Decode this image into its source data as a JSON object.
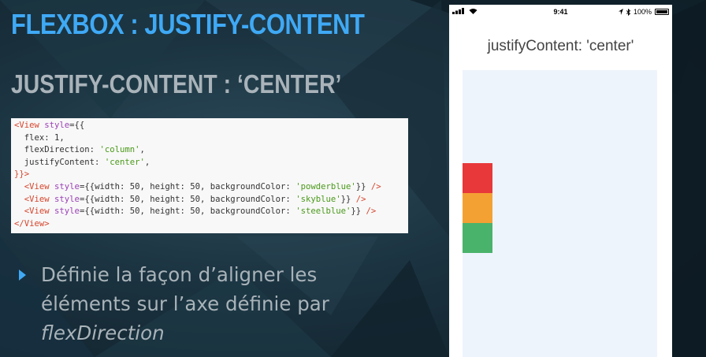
{
  "slide": {
    "title": "FLEXBOX : JUSTIFY-CONTENT",
    "subtitle": "JUSTIFY-CONTENT : ‘CENTER’",
    "accent_color": "#3fa9f5",
    "bullet": {
      "line1": "Définie la façon d’aligner les",
      "line2": "éléments sur l’axe définie par",
      "line3": "flexDirection"
    }
  },
  "code": {
    "lines": [
      [
        {
          "t": "tag",
          "v": "<View"
        },
        {
          "t": "attr",
          "v": " style"
        },
        {
          "t": "punc",
          "v": "={{"
        }
      ],
      [
        {
          "t": "prop",
          "v": "  flex: "
        },
        {
          "t": "num",
          "v": "1"
        },
        {
          "t": "punc",
          "v": ","
        }
      ],
      [
        {
          "t": "prop",
          "v": "  flexDirection: "
        },
        {
          "t": "str",
          "v": "'column'"
        },
        {
          "t": "punc",
          "v": ","
        }
      ],
      [
        {
          "t": "prop",
          "v": "  justifyContent: "
        },
        {
          "t": "str",
          "v": "'center'"
        },
        {
          "t": "punc",
          "v": ","
        }
      ],
      [
        {
          "t": "tag",
          "v": "}}>"
        }
      ],
      [
        {
          "t": "tag",
          "v": "  <View"
        },
        {
          "t": "attr",
          "v": " style"
        },
        {
          "t": "punc",
          "v": "={{width: 50, height: 50, backgroundColor: "
        },
        {
          "t": "str",
          "v": "'powderblue'"
        },
        {
          "t": "punc",
          "v": "}} "
        },
        {
          "t": "tag",
          "v": "/>"
        }
      ],
      [
        {
          "t": "tag",
          "v": "  <View"
        },
        {
          "t": "attr",
          "v": " style"
        },
        {
          "t": "punc",
          "v": "={{width: 50, height: 50, backgroundColor: "
        },
        {
          "t": "str",
          "v": "'skyblue'"
        },
        {
          "t": "punc",
          "v": "}} "
        },
        {
          "t": "tag",
          "v": "/>"
        }
      ],
      [
        {
          "t": "tag",
          "v": "  <View"
        },
        {
          "t": "attr",
          "v": " style"
        },
        {
          "t": "punc",
          "v": "={{width: 50, height: 50, backgroundColor: "
        },
        {
          "t": "str",
          "v": "'steelblue'"
        },
        {
          "t": "punc",
          "v": "}} "
        },
        {
          "t": "tag",
          "v": "/>"
        }
      ],
      [
        {
          "t": "tag",
          "v": "</View>"
        }
      ]
    ]
  },
  "phone": {
    "time": "9:41",
    "battery_text": "100%",
    "battery_level": 1.0,
    "heading": "justifyContent: 'center'",
    "container_color": "#eef4fc",
    "boxes": [
      {
        "name": "red-box",
        "color": "#e8383a"
      },
      {
        "name": "orange-box",
        "color": "#f4a133"
      },
      {
        "name": "green-box",
        "color": "#4ab36b"
      }
    ]
  }
}
